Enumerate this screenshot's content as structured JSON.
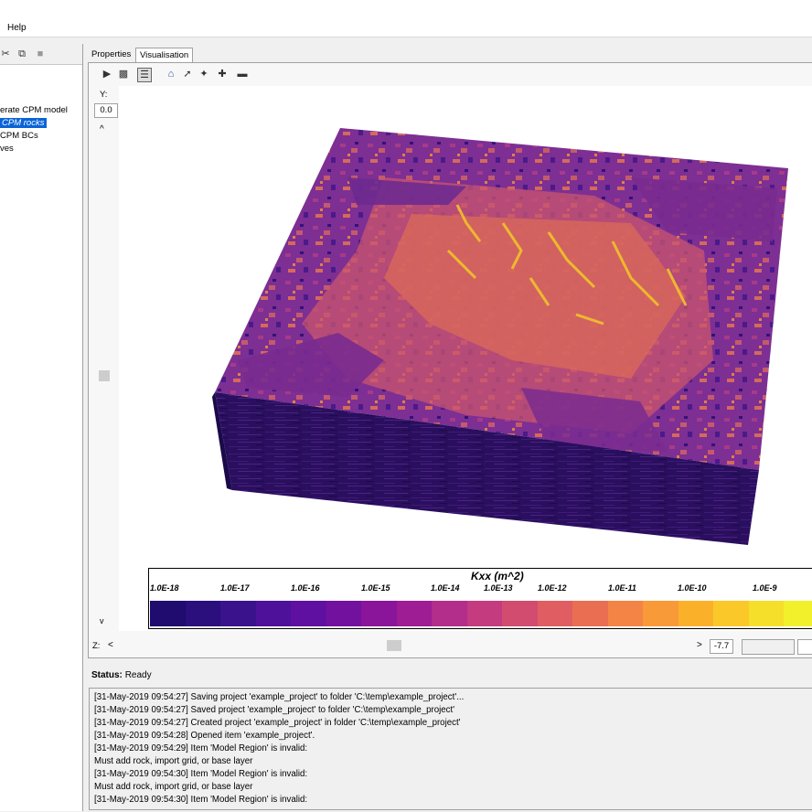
{
  "menu": {
    "help": "Help"
  },
  "tabs": [
    {
      "label": "Properties"
    },
    {
      "label": "Visualisation"
    }
  ],
  "tree": {
    "items": [
      {
        "label": "erate CPM model"
      },
      {
        "label": "CPM rocks"
      },
      {
        "label": "CPM BCs"
      },
      {
        "label": "ves"
      }
    ]
  },
  "viewer": {
    "y_label": "Y:",
    "y_value": "0.0",
    "z_label": "Z:",
    "z_value": "-7.7",
    "scroll_left": "<",
    "scroll_right": ">",
    "scroll_up": "^",
    "scroll_down": "v"
  },
  "colorbar": {
    "title": "Kxx (m^2)",
    "ticks": [
      "1.0E-18",
      "1.0E-17",
      "1.0E-16",
      "1.0E-15",
      "1.0E-14",
      "1.0E-13",
      "1.0E-12",
      "1.0E-11",
      "1.0E-10",
      "1.0E-9"
    ],
    "colors": [
      "#1f0c6e",
      "#2a0f7d",
      "#3a128c",
      "#4d1299",
      "#5f10a0",
      "#73119f",
      "#8a159b",
      "#9e1c94",
      "#b32d8a",
      "#c43b7f",
      "#d24c70",
      "#e05d62",
      "#ea6f52",
      "#f38445",
      "#f89a37",
      "#fbb02a",
      "#fbc829",
      "#f6df2a",
      "#f2f02b"
    ]
  },
  "status": {
    "label": "Status:",
    "value": "Ready"
  },
  "log": [
    "[31-May-2019 09:54:27] Saving project 'example_project' to folder 'C:\\temp\\example_project'...",
    "[31-May-2019 09:54:27] Saved project 'example_project' to folder 'C:\\temp\\example_project'",
    "[31-May-2019 09:54:27] Created project 'example_project' in folder 'C:\\temp\\example_project'",
    "[31-May-2019 09:54:28] Opened item 'example_project'.",
    "[31-May-2019 09:54:29] Item 'Model Region' is invalid:",
    "Must add rock, import grid, or base layer",
    "[31-May-2019 09:54:30] Item 'Model Region' is invalid:",
    "Must add rock, import grid, or base layer",
    "[31-May-2019 09:54:30] Item 'Model Region' is invalid:"
  ]
}
